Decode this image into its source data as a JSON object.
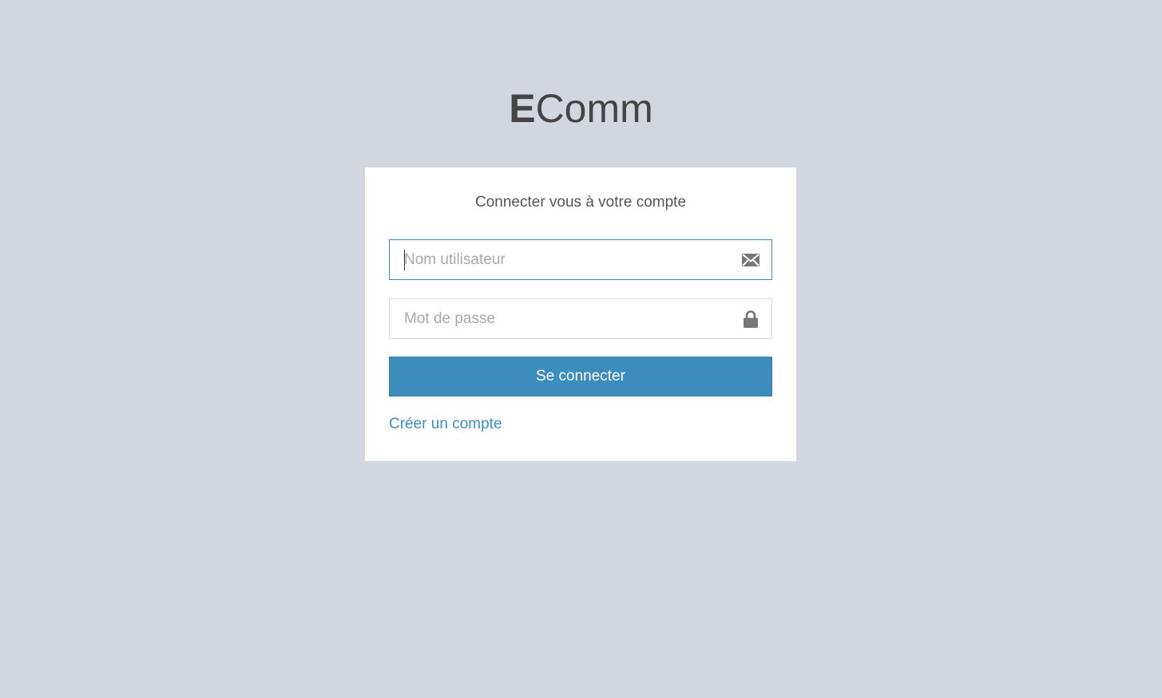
{
  "logo": {
    "bold": "E",
    "light": "Comm"
  },
  "login": {
    "message": "Connecter vous à votre compte",
    "username": {
      "placeholder": "Nom utilisateur",
      "value": "",
      "icon": "envelope-icon"
    },
    "password": {
      "placeholder": "Mot de passe",
      "value": "",
      "icon": "lock-icon"
    },
    "submit_label": "Se connecter",
    "register_link": "Créer un compte"
  },
  "colors": {
    "background": "#d2d6de",
    "accent": "#3c8dbc",
    "text": "#555555",
    "icon": "#777777"
  }
}
